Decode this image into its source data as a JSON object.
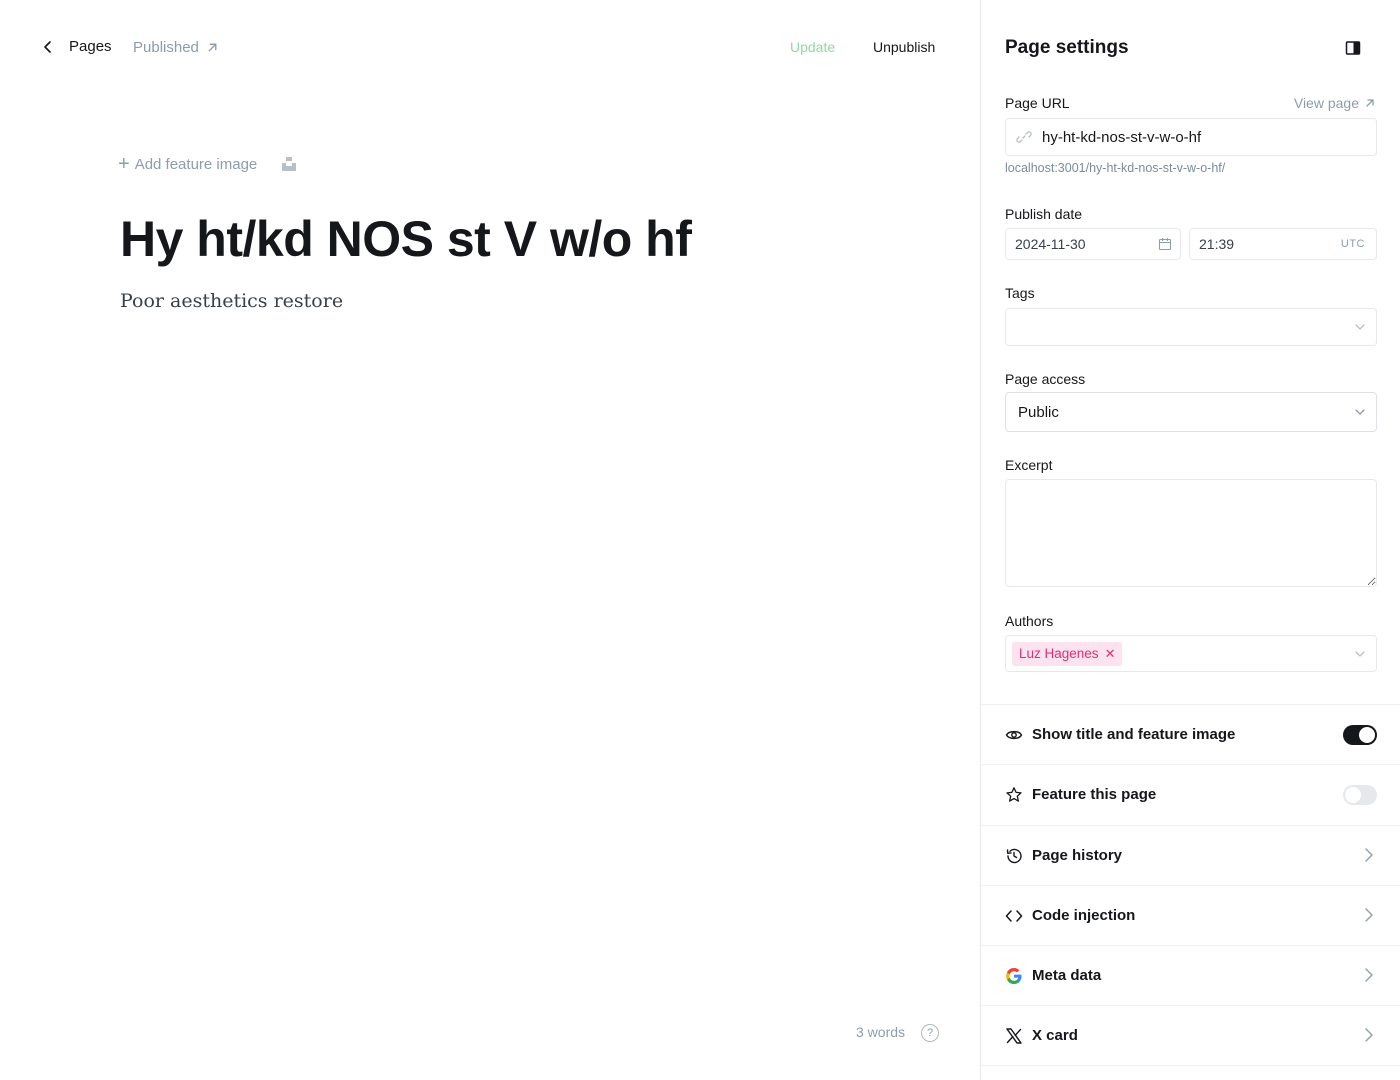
{
  "editor": {
    "back_label": "Pages",
    "status": "Published",
    "update_label": "Update",
    "unpublish_label": "Unpublish",
    "add_feature_image": "Add feature image",
    "title": "Hy ht/kd NOS st V w/o hf",
    "excerpt": "Poor aesthetics restore",
    "word_count": "3 words",
    "help_glyph": "?"
  },
  "settings": {
    "title": "Page settings",
    "url": {
      "label": "Page URL",
      "view_page": "View page",
      "value": "hy-ht-kd-nos-st-v-w-o-hf",
      "hint": "localhost:3001/hy-ht-kd-nos-st-v-w-o-hf/"
    },
    "publish_date": {
      "label": "Publish date",
      "date": "2024-11-30",
      "time": "21:39",
      "timezone": "UTC"
    },
    "tags": {
      "label": "Tags",
      "value": ""
    },
    "access": {
      "label": "Page access",
      "value": "Public"
    },
    "excerpt": {
      "label": "Excerpt",
      "value": ""
    },
    "authors": {
      "label": "Authors",
      "items": [
        "Luz Hagenes"
      ]
    },
    "rows": [
      {
        "label": "Show title and feature image",
        "icon": "eye-icon",
        "toggle": "on"
      },
      {
        "label": "Feature this page",
        "icon": "star-icon",
        "toggle": "off"
      },
      {
        "label": "Page history",
        "icon": "history-icon"
      },
      {
        "label": "Code injection",
        "icon": "code-icon"
      },
      {
        "label": "Meta data",
        "icon": "google-icon"
      },
      {
        "label": "X card",
        "icon": "x-logo-icon"
      }
    ]
  },
  "colors": {
    "accent_pink": "#d8307b",
    "update_green": "#8fd9a3",
    "muted": "#8e9cac"
  }
}
